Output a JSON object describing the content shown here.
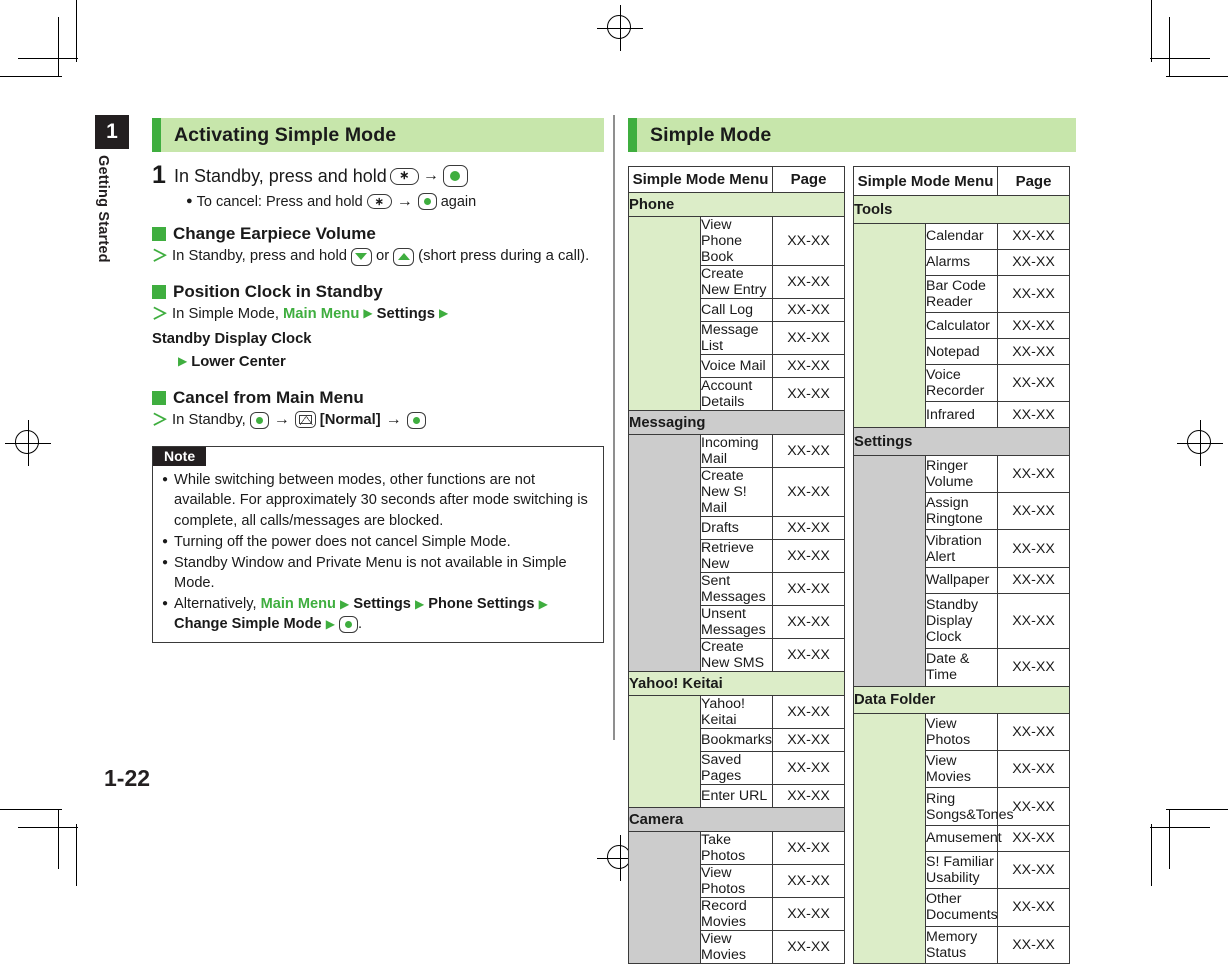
{
  "document": {
    "chapter_number": "1",
    "chapter_title": "Getting Started",
    "folio": "1-22"
  },
  "left_column": {
    "header": "Activating Simple Mode",
    "step": {
      "number": "1",
      "text_before": "In Standby, press and hold",
      "key_star": "∗",
      "arrow": "→",
      "sub_bullet": "●",
      "sub_text_before": "To cancel: Press and hold",
      "sub_text_after": "again"
    },
    "sections": [
      {
        "heading": "Change Earpiece Volume",
        "lines": [
          {
            "marker": "＞",
            "parts": [
              "In Standby, press and hold",
              "or",
              "(short press during a call)."
            ]
          }
        ]
      },
      {
        "heading": "Position Clock in Standby",
        "lines": [
          {
            "marker": "＞",
            "prefix": "In Simple Mode,",
            "green": "Main Menu",
            "b1": "Settings",
            "b2": "Standby Display Clock",
            "b3": "Lower Center"
          }
        ]
      },
      {
        "heading": "Cancel from Main Menu",
        "lines": [
          {
            "marker": "＞",
            "prefix": "In Standby,",
            "normal_label": "[Normal]"
          }
        ]
      }
    ],
    "note": {
      "label": "Note",
      "items": [
        {
          "text": "While switching between modes, other functions are not available. For approximately 30 seconds after mode switching is complete, all calls/messages are blocked."
        },
        {
          "text": "Turning off the power does not cancel Simple Mode."
        },
        {
          "text": "Standby Window and Private Menu is not available in Simple Mode."
        },
        {
          "prefix": "Alternatively,",
          "green": "Main Menu",
          "b1": "Settings",
          "b2": "Phone Settings",
          "b3": "Change Simple Mode",
          "suffix": "."
        }
      ]
    }
  },
  "right_column": {
    "header": "Simple Mode",
    "table_headers": {
      "menu": "Simple Mode Menu",
      "page": "Page"
    },
    "table_left": [
      {
        "group": "Phone",
        "tone": "green",
        "rows": [
          {
            "name": "View Phone Book",
            "page": "XX-XX"
          },
          {
            "name": "Create New Entry",
            "page": "XX-XX"
          },
          {
            "name": "Call Log",
            "page": "XX-XX"
          },
          {
            "name": "Message List",
            "page": "XX-XX"
          },
          {
            "name": "Voice Mail",
            "page": "XX-XX"
          },
          {
            "name": "Account Details",
            "page": "XX-XX"
          }
        ]
      },
      {
        "group": "Messaging",
        "tone": "grey",
        "rows": [
          {
            "name": "Incoming Mail",
            "page": "XX-XX"
          },
          {
            "name": "Create New S! Mail",
            "page": "XX-XX"
          },
          {
            "name": "Drafts",
            "page": "XX-XX"
          },
          {
            "name": "Retrieve New",
            "page": "XX-XX"
          },
          {
            "name": "Sent Messages",
            "page": "XX-XX"
          },
          {
            "name": "Unsent Messages",
            "page": "XX-XX"
          },
          {
            "name": "Create New SMS",
            "page": "XX-XX"
          }
        ]
      },
      {
        "group": "Yahoo! Keitai",
        "tone": "green",
        "rows": [
          {
            "name": "Yahoo! Keitai",
            "page": "XX-XX"
          },
          {
            "name": "Bookmarks",
            "page": "XX-XX"
          },
          {
            "name": "Saved Pages",
            "page": "XX-XX"
          },
          {
            "name": "Enter URL",
            "page": "XX-XX"
          }
        ]
      },
      {
        "group": "Camera",
        "tone": "grey",
        "rows": [
          {
            "name": "Take Photos",
            "page": "XX-XX"
          },
          {
            "name": "View Photos",
            "page": "XX-XX"
          },
          {
            "name": "Record Movies",
            "page": "XX-XX"
          },
          {
            "name": "View Movies",
            "page": "XX-XX"
          }
        ]
      }
    ],
    "table_right": [
      {
        "group": "Tools",
        "tone": "green",
        "rows": [
          {
            "name": "Calendar",
            "page": "XX-XX"
          },
          {
            "name": "Alarms",
            "page": "XX-XX"
          },
          {
            "name": "Bar Code Reader",
            "page": "XX-XX"
          },
          {
            "name": "Calculator",
            "page": "XX-XX"
          },
          {
            "name": "Notepad",
            "page": "XX-XX"
          },
          {
            "name": "Voice Recorder",
            "page": "XX-XX"
          },
          {
            "name": "Infrared",
            "page": "XX-XX"
          }
        ]
      },
      {
        "group": "Settings",
        "tone": "grey",
        "rows": [
          {
            "name": "Ringer Volume",
            "page": "XX-XX"
          },
          {
            "name": "Assign Ringtone",
            "page": "XX-XX"
          },
          {
            "name": "Vibration Alert",
            "page": "XX-XX"
          },
          {
            "name": "Wallpaper",
            "page": "XX-XX"
          },
          {
            "name": "Standby Display Clock",
            "page": "XX-XX"
          },
          {
            "name": "Date & Time",
            "page": "XX-XX"
          }
        ]
      },
      {
        "group": "Data Folder",
        "tone": "green",
        "rows": [
          {
            "name": "View Photos",
            "page": "XX-XX"
          },
          {
            "name": "View Movies",
            "page": "XX-XX"
          },
          {
            "name": "Ring Songs&Tones",
            "page": "XX-XX"
          },
          {
            "name": "Amusement",
            "page": "XX-XX"
          },
          {
            "name": "S! Familiar Usability",
            "page": "XX-XX"
          },
          {
            "name": "Other Documents",
            "page": "XX-XX"
          },
          {
            "name": "Memory Status",
            "page": "XX-XX"
          }
        ]
      }
    ]
  },
  "colors": {
    "header_bg": "#c7e6ab",
    "header_accent": "#3fae3f",
    "green_text": "#3fae3f",
    "group_green": "#dcedc8",
    "group_grey": "#cccccc",
    "chapter_tab": "#231f20"
  }
}
